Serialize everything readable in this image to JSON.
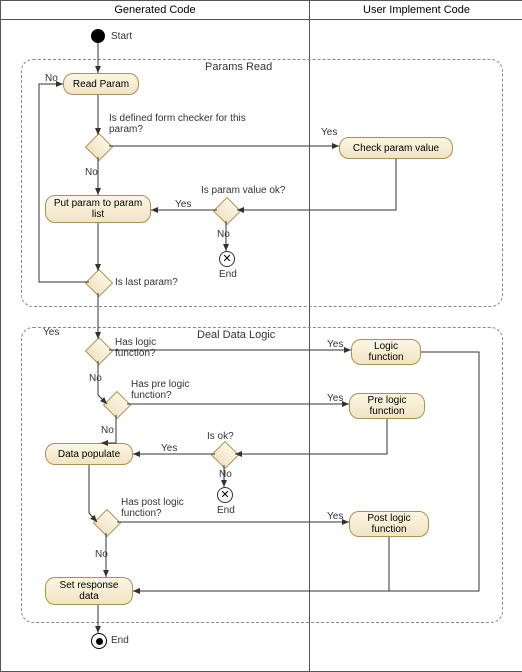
{
  "chart_data": {
    "type": "activity-diagram",
    "swimlanes": [
      "Generated Code",
      "User Implement Code"
    ],
    "regions": [
      {
        "name": "Params Read"
      },
      {
        "name": "Deal Data Logic"
      }
    ],
    "nodes": [
      {
        "id": "start",
        "type": "initial",
        "label": "Start",
        "lane": 0
      },
      {
        "id": "read_param",
        "type": "activity",
        "label": "Read Param",
        "lane": 0
      },
      {
        "id": "d_checker",
        "type": "decision",
        "label": "Is defined form checker for this param?",
        "lane": 0
      },
      {
        "id": "check_param",
        "type": "activity",
        "label": "Check param value",
        "lane": 1
      },
      {
        "id": "d_value_ok",
        "type": "decision",
        "label": "Is param value ok?",
        "lane": 0
      },
      {
        "id": "put_param",
        "type": "activity",
        "label": "Put param to param list",
        "lane": 0
      },
      {
        "id": "end1",
        "type": "flow-final",
        "label": "End",
        "lane": 0
      },
      {
        "id": "d_last",
        "type": "decision",
        "label": "Is last param?",
        "lane": 0
      },
      {
        "id": "d_logic",
        "type": "decision",
        "label": "Has logic function?",
        "lane": 0
      },
      {
        "id": "logic_fn",
        "type": "activity",
        "label": "Logic function",
        "lane": 1
      },
      {
        "id": "d_pre",
        "type": "decision",
        "label": "Has pre logic function?",
        "lane": 0
      },
      {
        "id": "pre_fn",
        "type": "activity",
        "label": "Pre logic function",
        "lane": 1
      },
      {
        "id": "d_ok",
        "type": "decision",
        "label": "Is ok?",
        "lane": 0
      },
      {
        "id": "data_pop",
        "type": "activity",
        "label": "Data populate",
        "lane": 0
      },
      {
        "id": "end2",
        "type": "flow-final",
        "label": "End",
        "lane": 0
      },
      {
        "id": "d_post",
        "type": "decision",
        "label": "Has post logic function?",
        "lane": 0
      },
      {
        "id": "post_fn",
        "type": "activity",
        "label": "Post logic function",
        "lane": 1
      },
      {
        "id": "set_resp",
        "type": "activity",
        "label": "Set response data",
        "lane": 0
      },
      {
        "id": "final",
        "type": "final",
        "label": "End",
        "lane": 0
      }
    ],
    "edges": [
      {
        "from": "start",
        "to": "read_param"
      },
      {
        "from": "read_param",
        "to": "d_checker"
      },
      {
        "from": "d_checker",
        "to": "check_param",
        "label": "Yes"
      },
      {
        "from": "d_checker",
        "to": "put_param",
        "label": "No"
      },
      {
        "from": "check_param",
        "to": "d_value_ok"
      },
      {
        "from": "d_value_ok",
        "to": "put_param",
        "label": "Yes"
      },
      {
        "from": "d_value_ok",
        "to": "end1",
        "label": "No"
      },
      {
        "from": "put_param",
        "to": "d_last"
      },
      {
        "from": "d_last",
        "to": "read_param",
        "label": "No"
      },
      {
        "from": "d_last",
        "to": "d_logic",
        "label": "Yes"
      },
      {
        "from": "d_logic",
        "to": "logic_fn",
        "label": "Yes"
      },
      {
        "from": "d_logic",
        "to": "d_pre",
        "label": "No"
      },
      {
        "from": "d_pre",
        "to": "pre_fn",
        "label": "Yes"
      },
      {
        "from": "d_pre",
        "to": "data_pop",
        "label": "No"
      },
      {
        "from": "pre_fn",
        "to": "d_ok"
      },
      {
        "from": "d_ok",
        "to": "data_pop",
        "label": "Yes"
      },
      {
        "from": "d_ok",
        "to": "end2",
        "label": "No"
      },
      {
        "from": "data_pop",
        "to": "d_post"
      },
      {
        "from": "d_post",
        "to": "post_fn",
        "label": "Yes"
      },
      {
        "from": "d_post",
        "to": "set_resp",
        "label": "No"
      },
      {
        "from": "post_fn",
        "to": "set_resp"
      },
      {
        "from": "logic_fn",
        "to": "set_resp"
      },
      {
        "from": "set_resp",
        "to": "final"
      }
    ]
  },
  "headers": {
    "left": "Generated Code",
    "right": "User Implement Code"
  },
  "regions": {
    "params": "Params Read",
    "deal": "Deal Data Logic"
  },
  "nodes": {
    "start": "Start",
    "read_param": "Read Param",
    "check_param": "Check param value",
    "put_param": "Put param to param list",
    "logic_fn": "Logic function",
    "pre_fn": "Pre logic function",
    "data_pop": "Data populate",
    "post_fn": "Post logic function",
    "set_resp": "Set response data",
    "end": "End"
  },
  "decisions": {
    "checker": "Is defined form checker for this param?",
    "checker_line2": "",
    "value_ok": "Is param value ok?",
    "last": "Is last param?",
    "logic": "Has logic function?",
    "pre": "Has pre logic function?",
    "ok": "Is ok?",
    "post": "Has post logic function?"
  },
  "guards": {
    "yes": "Yes",
    "no": "No"
  }
}
